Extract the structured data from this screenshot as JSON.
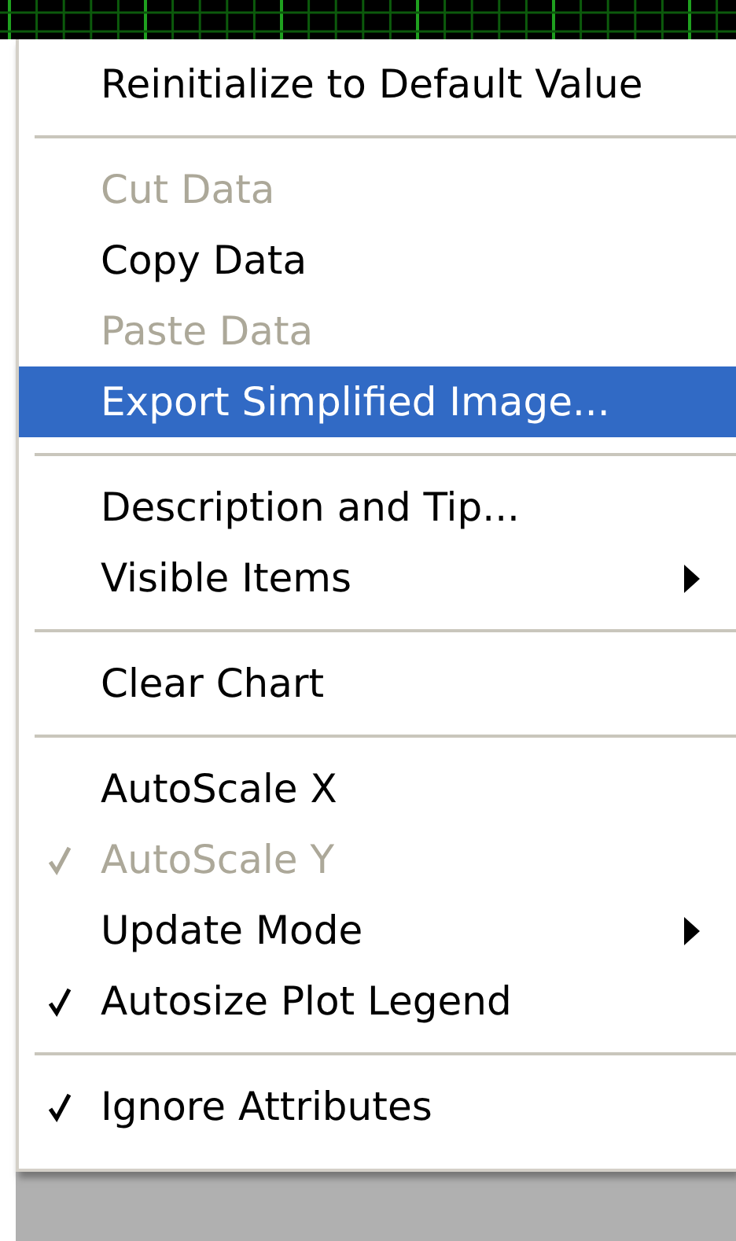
{
  "menu": {
    "groups": [
      [
        {
          "label": "Reinitialize to Default Value",
          "disabled": false,
          "selected": false,
          "checked": false,
          "submenu": false
        }
      ],
      [
        {
          "label": "Cut Data",
          "disabled": true,
          "selected": false,
          "checked": false,
          "submenu": false
        },
        {
          "label": "Copy Data",
          "disabled": false,
          "selected": false,
          "checked": false,
          "submenu": false
        },
        {
          "label": "Paste Data",
          "disabled": true,
          "selected": false,
          "checked": false,
          "submenu": false
        },
        {
          "label": "Export Simplified Image...",
          "disabled": false,
          "selected": true,
          "checked": false,
          "submenu": false
        }
      ],
      [
        {
          "label": "Description and Tip...",
          "disabled": false,
          "selected": false,
          "checked": false,
          "submenu": false
        },
        {
          "label": "Visible Items",
          "disabled": false,
          "selected": false,
          "checked": false,
          "submenu": true
        }
      ],
      [
        {
          "label": "Clear Chart",
          "disabled": false,
          "selected": false,
          "checked": false,
          "submenu": false
        }
      ],
      [
        {
          "label": "AutoScale X",
          "disabled": false,
          "selected": false,
          "checked": false,
          "submenu": false
        },
        {
          "label": "AutoScale Y",
          "disabled": true,
          "selected": false,
          "checked": true,
          "submenu": false
        },
        {
          "label": "Update Mode",
          "disabled": false,
          "selected": false,
          "checked": false,
          "submenu": true
        },
        {
          "label": "Autosize Plot Legend",
          "disabled": false,
          "selected": false,
          "checked": true,
          "submenu": false
        }
      ],
      [
        {
          "label": "Ignore Attributes",
          "disabled": false,
          "selected": false,
          "checked": true,
          "submenu": false
        }
      ]
    ]
  }
}
